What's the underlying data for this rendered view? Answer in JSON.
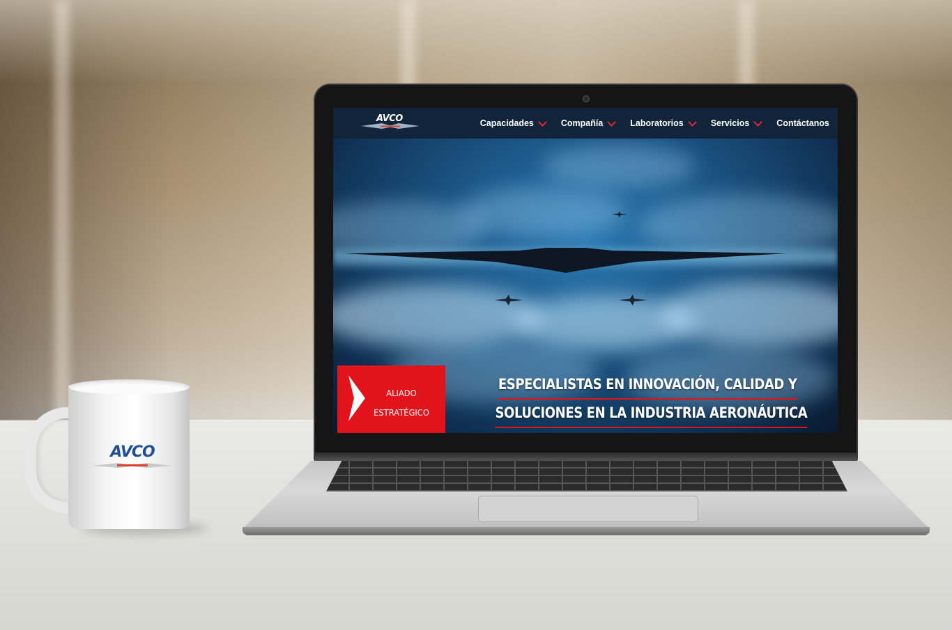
{
  "site": {
    "logo_text": "AVCO",
    "nav": [
      {
        "label": "Capacidades",
        "has_dropdown": true
      },
      {
        "label": "Compañía",
        "has_dropdown": true
      },
      {
        "label": "Laboratorios",
        "has_dropdown": true
      },
      {
        "label": "Servicios",
        "has_dropdown": true
      },
      {
        "label": "Contáctanos",
        "has_dropdown": false
      }
    ],
    "badge": {
      "line1": "ALIADO",
      "line2": "ESTRATÉGICO"
    },
    "headline": {
      "line1": "ESPECIALISTAS EN INNOVACIÓN, CALIDAD Y",
      "line2": "SOLUCIONES EN LA INDUSTRIA AERONÁUTICA"
    }
  },
  "mug": {
    "logo_text": "AVCO"
  },
  "colors": {
    "nav_background": "#12243a",
    "accent_red": "#e3131b",
    "hero_blue": "#1b5584"
  }
}
